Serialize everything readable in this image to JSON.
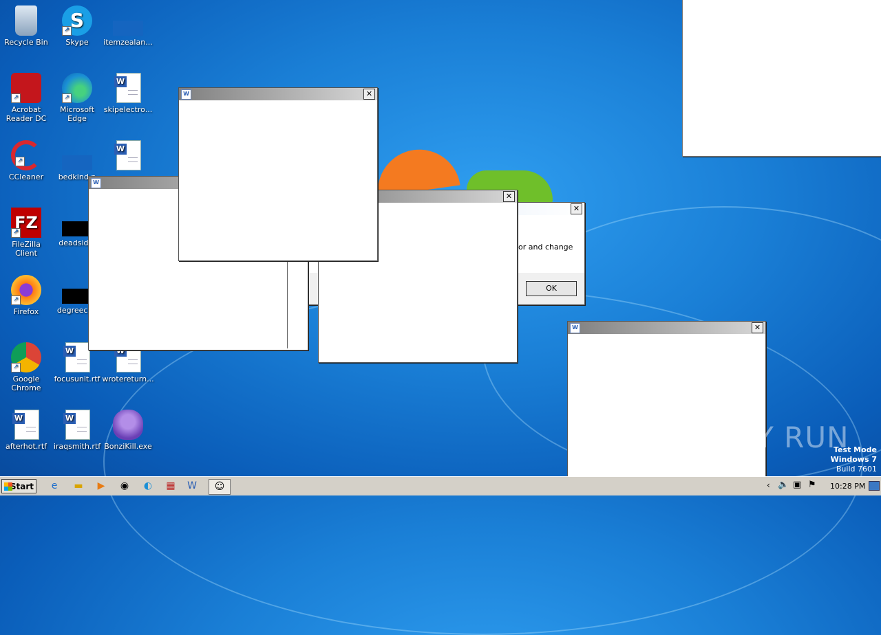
{
  "desktop_icons": [
    {
      "label": "Recycle Bin"
    },
    {
      "label": "Skype"
    },
    {
      "label": "itemzealan..."
    },
    {
      "label": "Acrobat Reader DC"
    },
    {
      "label": "Microsoft Edge"
    },
    {
      "label": "skipelectro..."
    },
    {
      "label": "CCleaner"
    },
    {
      "label": "bedkind.p"
    },
    {
      "label": ""
    },
    {
      "label": "FileZilla Client"
    },
    {
      "label": "deadside."
    },
    {
      "label": "Firefox"
    },
    {
      "label": "degreecou"
    },
    {
      "label": "Google Chrome"
    },
    {
      "label": "focusunit.rtf"
    },
    {
      "label": "wrotereturn..."
    },
    {
      "label": "afterhot.rtf"
    },
    {
      "label": "iraqsmith.rtf"
    },
    {
      "label": "BonziKill.exe"
    }
  ],
  "dialog": {
    "partial_text": "or and change",
    "ok_label": "OK"
  },
  "window_controls": {
    "close_glyph": "✕",
    "doc_glyph": "W"
  },
  "taskbar": {
    "start_label": "Start",
    "clock": "10:28 PM"
  },
  "watermark": {
    "brand": "ANY RUN",
    "mode": "Test Mode",
    "os": "Windows 7",
    "build": "Build 7601"
  }
}
